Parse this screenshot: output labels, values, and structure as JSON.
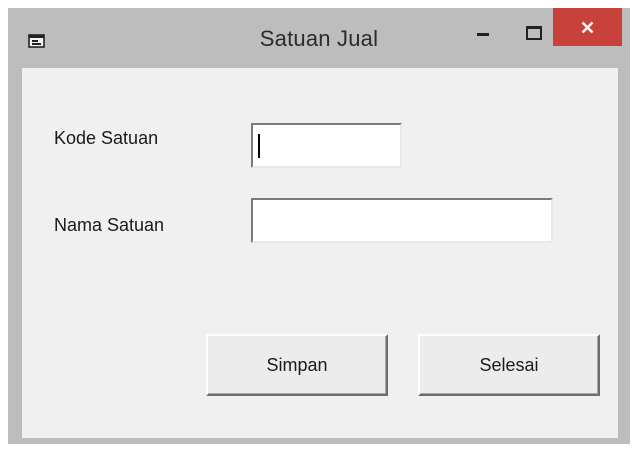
{
  "window": {
    "title": "Satuan Jual",
    "controls": {
      "minimize_icon": "minimize-icon",
      "maximize_icon": "maximize-icon",
      "close_icon": "close-icon",
      "close_color": "#c9413b"
    }
  },
  "form": {
    "kode_label": "Kode Satuan",
    "kode_value": "",
    "nama_label": "Nama Satuan",
    "nama_value": ""
  },
  "buttons": {
    "simpan_label": "Simpan",
    "selesai_label": "Selesai"
  }
}
